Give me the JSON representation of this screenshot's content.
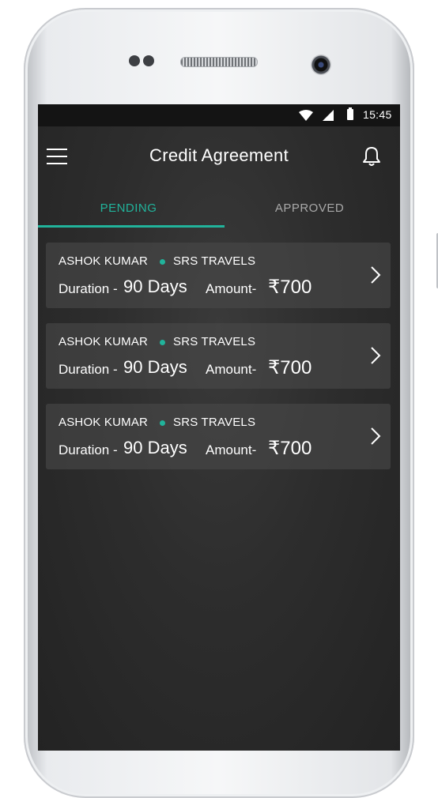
{
  "status_bar": {
    "time": "15:45"
  },
  "header": {
    "title": "Credit Agreement",
    "menu_icon": "hamburger-menu-icon",
    "notification_icon": "bell-icon"
  },
  "tabs": [
    {
      "label": "PENDING",
      "active": true
    },
    {
      "label": "APPROVED",
      "active": false
    }
  ],
  "colors": {
    "accent": "#21b39b",
    "inactive_tab": "#a9a9a9",
    "background": "#2d2d2d"
  },
  "agreements": [
    {
      "customer": "ASHOK KUMAR",
      "company": "SRS TRAVELS",
      "duration_label": "Duration -",
      "duration_value": "90 Days",
      "amount_label": "Amount-",
      "amount_value": "₹700"
    },
    {
      "customer": "ASHOK KUMAR",
      "company": "SRS TRAVELS",
      "duration_label": "Duration -",
      "duration_value": "90 Days",
      "amount_label": "Amount-",
      "amount_value": "₹700"
    },
    {
      "customer": "ASHOK KUMAR",
      "company": "SRS TRAVELS",
      "duration_label": "Duration -",
      "duration_value": "90 Days",
      "amount_label": "Amount-",
      "amount_value": "₹700"
    }
  ]
}
